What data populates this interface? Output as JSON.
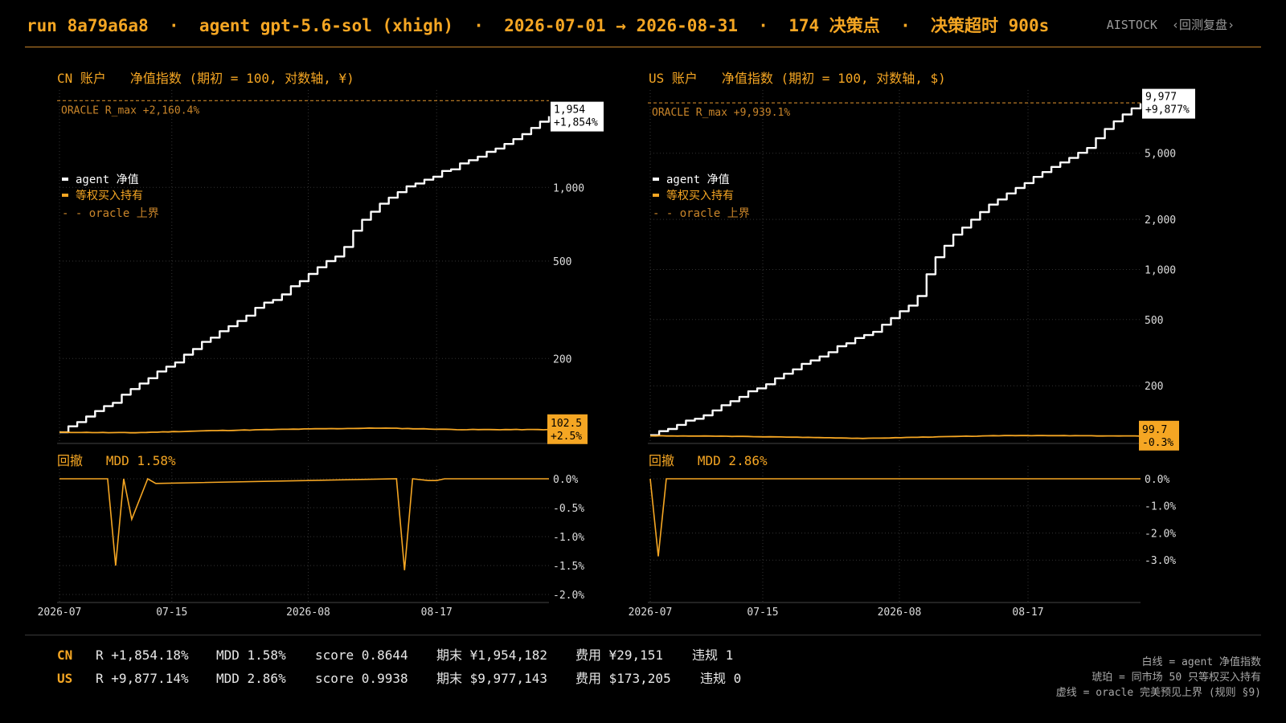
{
  "header": {
    "title": "run 8a79a6a8  ·  agent gpt-5.6-sol (xhigh)  ·  2026-07-01 → 2026-08-31  ·  174 决策点  ·  决策超时 900s",
    "brand": "AISTOCK",
    "back_link": "‹回测复盘›"
  },
  "colors": {
    "accent": "#f5a623",
    "agent": "#ffffff",
    "oracle": "#c9852a",
    "background": "#000000",
    "grid": "#444444"
  },
  "panels": [
    {
      "market": "CN 账户",
      "title": "净值指数 (期初 = 100, 对数轴, ¥)",
      "legend": [
        "agent 净值",
        "等权买入持有",
        "- - oracle 上界"
      ],
      "oracle_label": "ORACLE R_max  +2,160.4%",
      "agent_end_value": "1,954",
      "agent_end_pct": "+1,854%",
      "bh_end_value": "102.5",
      "bh_end_pct": "+2.5%",
      "dd_title": "回撤   MDD 1.58%"
    },
    {
      "market": "US 账户",
      "title": "净值指数 (期初 = 100, 对数轴, $)",
      "legend": [
        "agent 净值",
        "等权买入持有",
        "- - oracle 上界"
      ],
      "oracle_label": "ORACLE R_max  +9,939.1%",
      "agent_end_value": "9,977",
      "agent_end_pct": "+9,877%",
      "bh_end_value": "99.7",
      "bh_end_pct": "-0.3%",
      "dd_title": "回撤   MDD 2.86%"
    }
  ],
  "chart_data": [
    {
      "type": "line",
      "title": "CN 账户  净值指数 (期初 = 100, 对数轴, ¥)",
      "x_axis": {
        "type": "date",
        "range": [
          "2026-07-01",
          "2026-08-31"
        ],
        "tick_labels": [
          "2026-07",
          "07-15",
          "2026-08",
          "08-17"
        ]
      },
      "y_axis": {
        "scale": "log",
        "range": [
          90,
          2500
        ],
        "tick_values": [
          200,
          500,
          1000
        ],
        "tick_labels": [
          "200",
          "500",
          "1,000"
        ]
      },
      "grid": true,
      "legend_position": "top-left",
      "series": [
        {
          "name": "agent 净值",
          "color": "#ffffff",
          "x": [
            "2026-07-01",
            "2026-07-08",
            "2026-07-15",
            "2026-07-22",
            "2026-07-29",
            "2026-08-05",
            "2026-08-08",
            "2026-08-12",
            "2026-08-19",
            "2026-08-26",
            "2026-08-31"
          ],
          "y": [
            100,
            135,
            190,
            270,
            370,
            540,
            760,
            960,
            1200,
            1520,
            1954
          ]
        },
        {
          "name": "等权买入持有",
          "color": "#f5a623",
          "x": [
            "2026-07-01",
            "2026-07-10",
            "2026-07-20",
            "2026-07-31",
            "2026-08-10",
            "2026-08-20",
            "2026-08-31"
          ],
          "y": [
            100,
            99.5,
            101.5,
            103,
            104,
            102.5,
            102.5
          ]
        },
        {
          "name": "oracle 上界",
          "color": "#c9852a",
          "dashed": true,
          "x": [
            "2026-07-01",
            "2026-08-31"
          ],
          "y": [
            2260.4,
            2260.4
          ]
        }
      ],
      "annotations": [
        "1,954 +1,854%",
        "102.5 +2.5%",
        "ORACLE R_max +2,160.4%"
      ]
    },
    {
      "type": "area",
      "title": "回撤  MDD 1.58%",
      "y_axis": {
        "range": [
          -2.0,
          0.0
        ],
        "tick_labels": [
          "0.0%",
          "-0.5%",
          "-1.0%",
          "-1.5%",
          "-2.0%"
        ]
      },
      "series": [
        {
          "name": "CN 回撤",
          "x": [
            "2026-07-01",
            "2026-07-07",
            "2026-07-08",
            "2026-07-09",
            "2026-07-10",
            "2026-07-12",
            "2026-07-13",
            "2026-08-12",
            "2026-08-13",
            "2026-08-14",
            "2026-08-16",
            "2026-08-17",
            "2026-08-18",
            "2026-08-31"
          ],
          "y": [
            0,
            0,
            -1.5,
            0,
            -0.7,
            0,
            -0.08,
            0,
            -1.58,
            0,
            -0.03,
            -0.03,
            0,
            0
          ]
        }
      ]
    },
    {
      "type": "line",
      "title": "US 账户  净值指数 (期初 = 100, 对数轴, $)",
      "x_axis": {
        "type": "date",
        "range": [
          "2026-07-01",
          "2026-08-31"
        ],
        "tick_labels": [
          "2026-07",
          "07-15",
          "2026-08",
          "08-17"
        ]
      },
      "y_axis": {
        "scale": "log",
        "range": [
          90,
          12000
        ],
        "tick_values": [
          200,
          500,
          1000,
          2000,
          5000
        ],
        "tick_labels": [
          "200",
          "500",
          "1,000",
          "2,000",
          "5,000"
        ]
      },
      "grid": true,
      "legend_position": "top-left",
      "series": [
        {
          "name": "agent 净值",
          "color": "#ffffff",
          "x": [
            "2026-07-01",
            "2026-07-08",
            "2026-07-15",
            "2026-07-22",
            "2026-07-29",
            "2026-08-03",
            "2026-08-06",
            "2026-08-10",
            "2026-08-17",
            "2026-08-24",
            "2026-08-31"
          ],
          "y": [
            100,
            135,
            200,
            300,
            430,
            640,
            1300,
            2000,
            3400,
            5200,
            9977
          ]
        },
        {
          "name": "等权买入持有",
          "color": "#f5a623",
          "x": [
            "2026-07-01",
            "2026-07-10",
            "2026-07-20",
            "2026-07-28",
            "2026-08-05",
            "2026-08-15",
            "2026-08-31"
          ],
          "y": [
            100,
            99.5,
            98,
            96.5,
            98.5,
            100.5,
            99.7
          ]
        },
        {
          "name": "oracle 上界",
          "color": "#c9852a",
          "dashed": true,
          "x": [
            "2026-07-01",
            "2026-08-31"
          ],
          "y": [
            10039.1,
            10039.1
          ]
        }
      ],
      "annotations": [
        "9,977 +9,877%",
        "99.7 -0.3%",
        "ORACLE R_max +9,939.1%"
      ]
    },
    {
      "type": "area",
      "title": "回撤  MDD 2.86%",
      "y_axis": {
        "range": [
          -3.5,
          0.3
        ],
        "tick_labels": [
          "0.0%",
          "-1.0%",
          "-2.0%",
          "-3.0%"
        ]
      },
      "series": [
        {
          "name": "US 回撤",
          "x": [
            "2026-07-01",
            "2026-07-02",
            "2026-07-03",
            "2026-08-31"
          ],
          "y": [
            0,
            -2.86,
            0,
            0
          ]
        }
      ]
    }
  ],
  "footer": {
    "rows": [
      {
        "market": "CN",
        "R": "R +1,854.18%",
        "mdd": "MDD 1.58%",
        "score": "score 0.8644",
        "end": "期末 ¥1,954,182",
        "fee": "费用 ¥29,151",
        "viol": "违规 1"
      },
      {
        "market": "US",
        "R": "R +9,877.14%",
        "mdd": "MDD 2.86%",
        "score": "score 0.9938",
        "end": "期末 $9,977,143",
        "fee": "费用 $173,205",
        "viol": "违规 0"
      }
    ],
    "notes": [
      "白线 = agent 净值指数",
      "琥珀 = 同市场 50 只等权买入持有",
      "虚线 = oracle 完美预见上界 (规则 §9)"
    ]
  }
}
